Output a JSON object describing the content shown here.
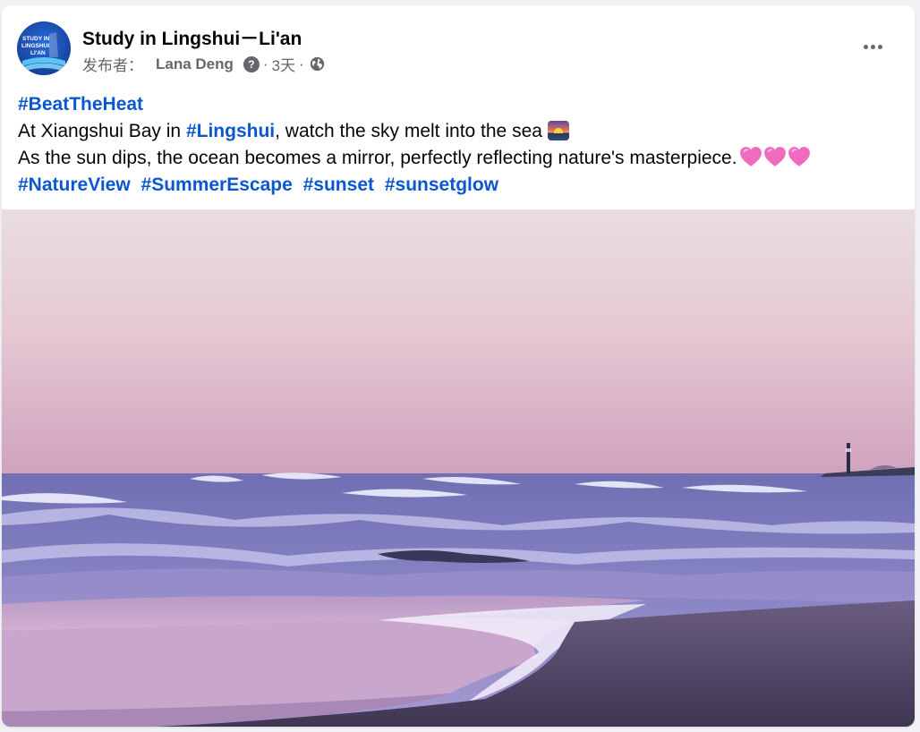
{
  "post": {
    "page_name": "Study in Lingshui－Li'an",
    "avatar_text": [
      "STUDY IN",
      "LINGSHUI",
      "LI'AN"
    ],
    "published_by_label": "发布者：",
    "author": "Lana Deng",
    "help_icon_glyph": "?",
    "separator": "·",
    "time": "3天",
    "privacy_icon": "globe-icon",
    "more_icon": "more-options-icon"
  },
  "text": {
    "hashtag_top": "#BeatTheHeat",
    "line2_before": "At Xiangshui Bay in ",
    "line2_tag": "#Lingshui",
    "line2_after": ", watch the sky melt into the sea",
    "line3": "As the sun dips, the ocean becomes a mirror, perfectly reflecting nature's masterpiece.",
    "hashtags": [
      "#NatureView",
      "#SummerEscape",
      "#sunset",
      "#sunsetglow"
    ]
  },
  "emojis": {
    "sunset": "sunset-emoji",
    "hearts": [
      "pink-heart-icon",
      "pink-heart-icon",
      "pink-heart-icon"
    ]
  },
  "colors": {
    "link": "#0b57d0",
    "text": "#050505",
    "secondary": "#65676b",
    "heart": "#f06bc0",
    "avatar": "#1b4fb5"
  }
}
